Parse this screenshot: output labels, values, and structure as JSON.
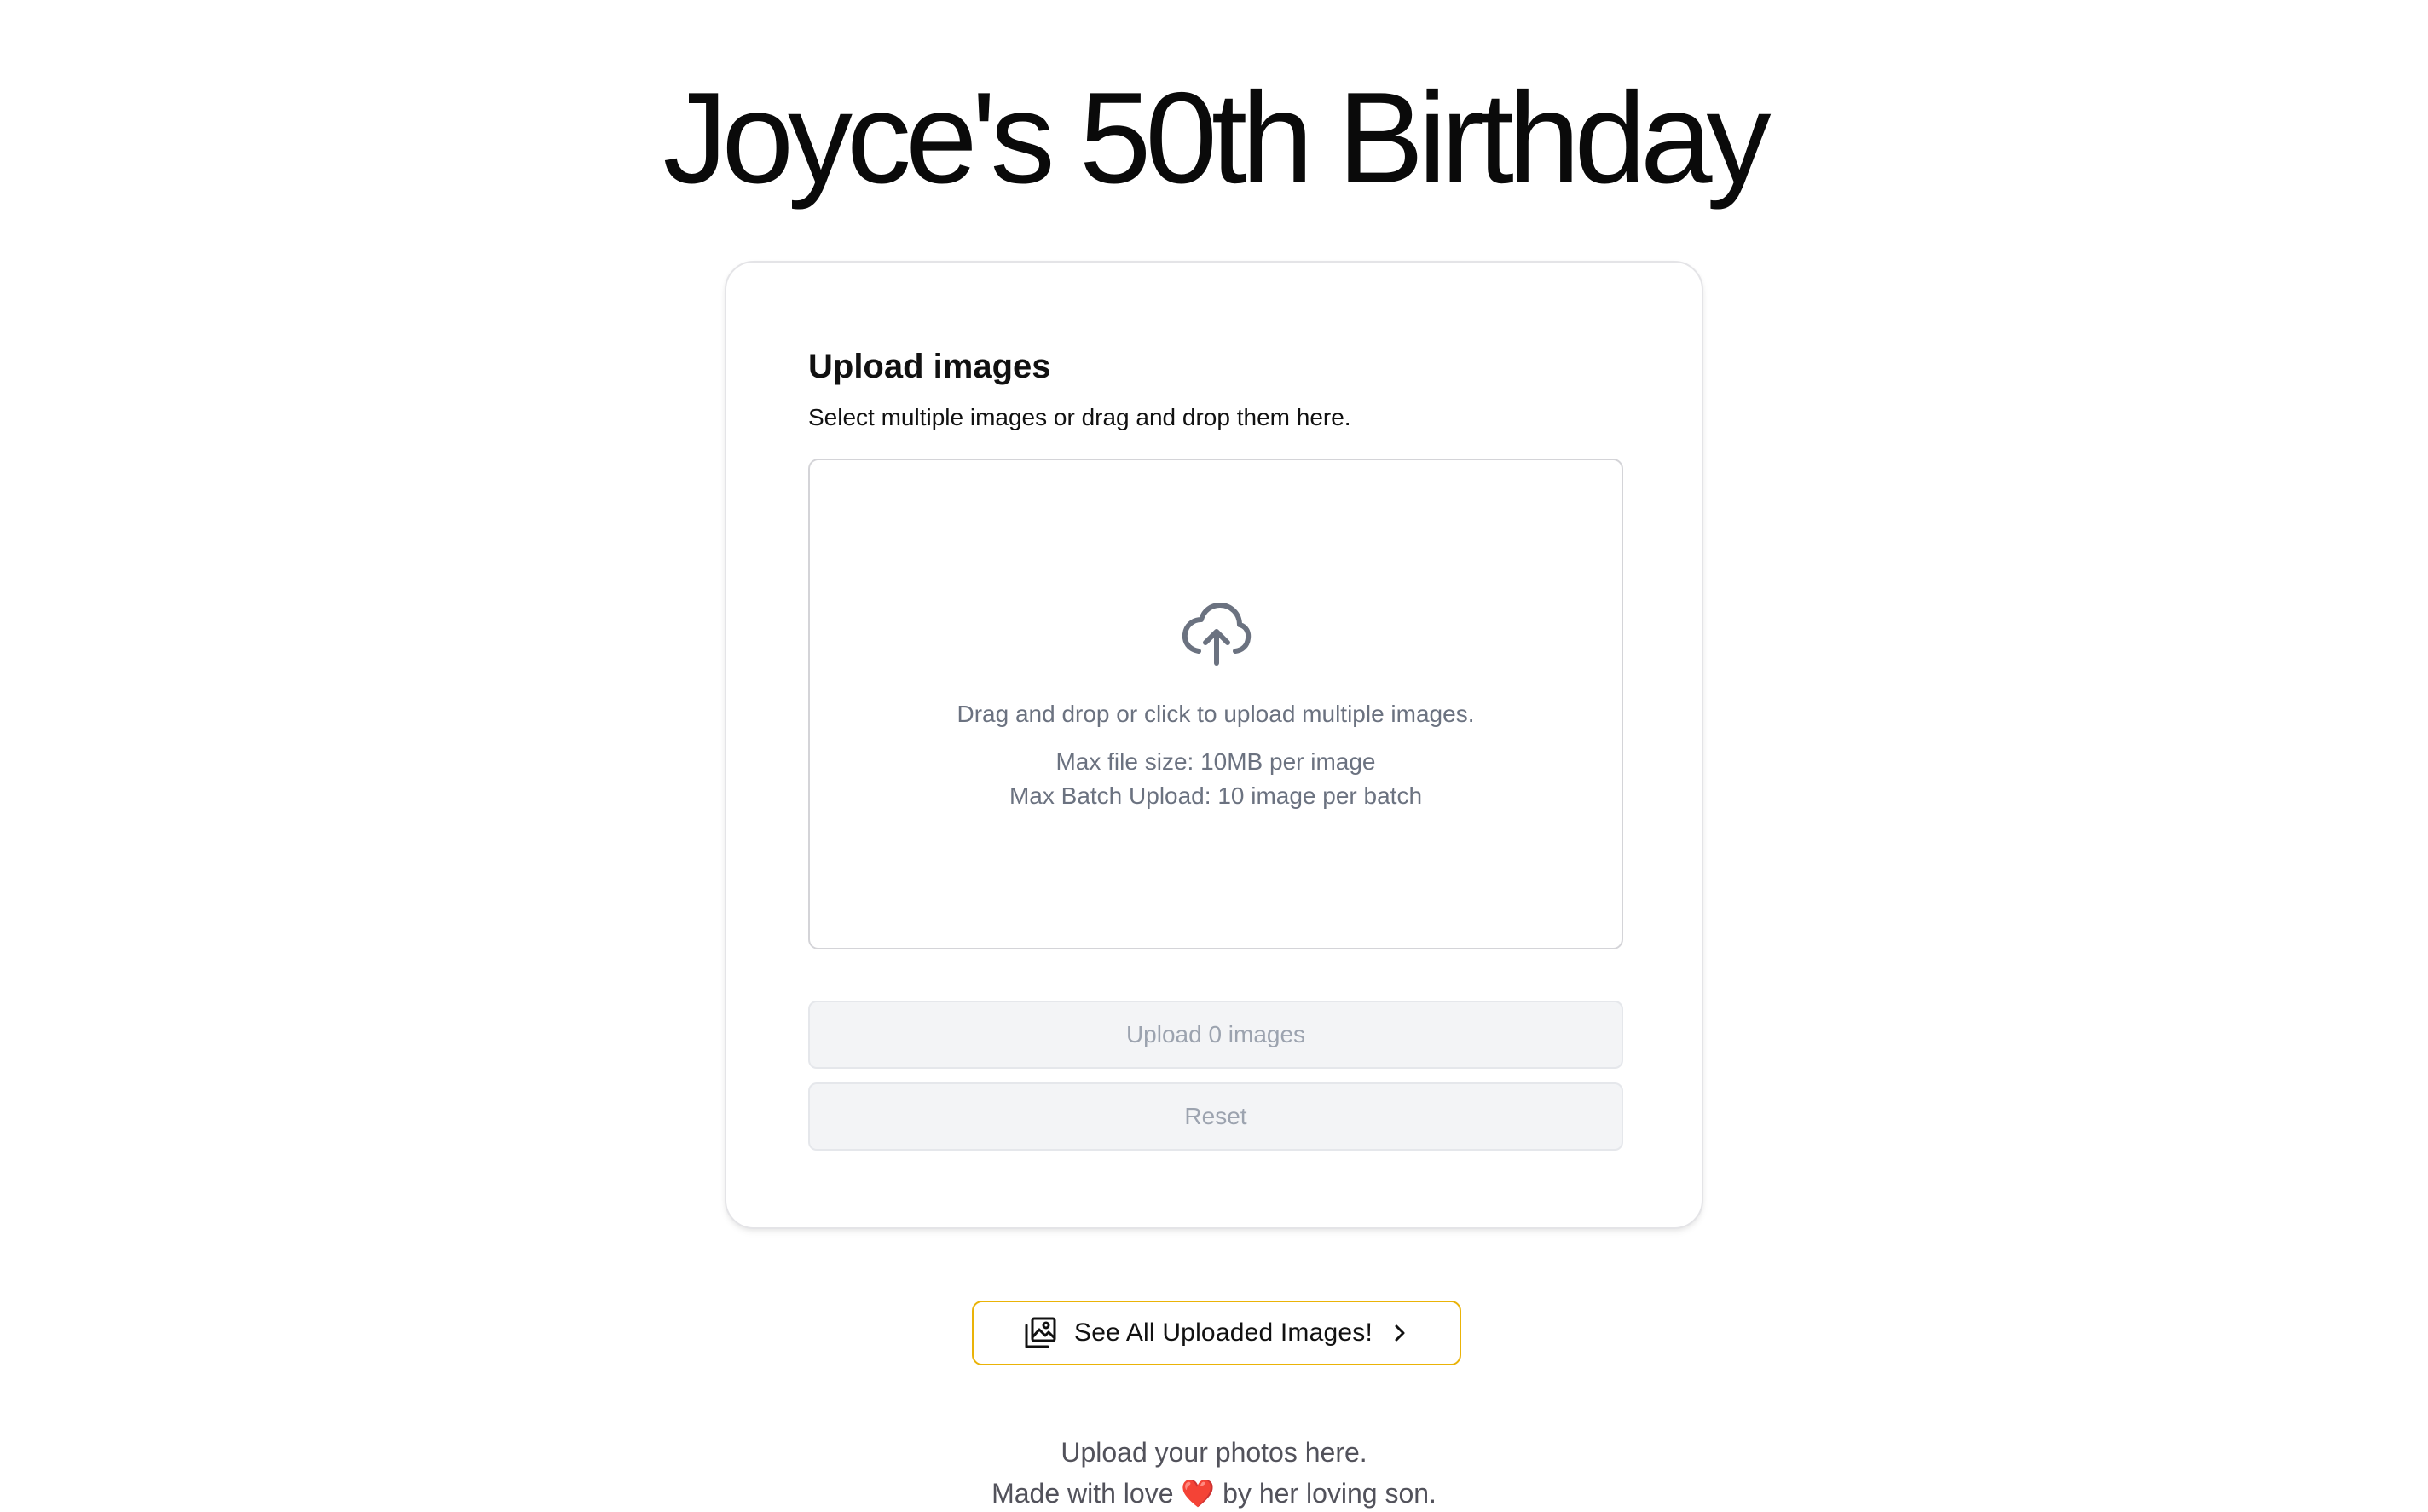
{
  "page": {
    "title": "Joyce's 50th Birthday"
  },
  "upload_card": {
    "heading": "Upload images",
    "subheading": "Select multiple images or drag and drop them here.",
    "dropzone": {
      "icon": "cloud-upload-icon",
      "main_text": "Drag and drop or click to upload multiple images.",
      "max_file_size": "Max file size: 10MB per image",
      "max_batch": "Max Batch Upload: 10 image per batch"
    },
    "upload_button_label": "Upload 0 images",
    "reset_button_label": "Reset"
  },
  "see_all_button": {
    "icon": "image-gallery-icon",
    "label": "See All Uploaded Images!",
    "chevron_icon": "chevron-right-icon",
    "border_color": "#eab308"
  },
  "footer": {
    "line1": "Upload your photos here.",
    "line2_before": "Made with love ",
    "heart": "❤️",
    "line2_after": " by her loving son."
  }
}
